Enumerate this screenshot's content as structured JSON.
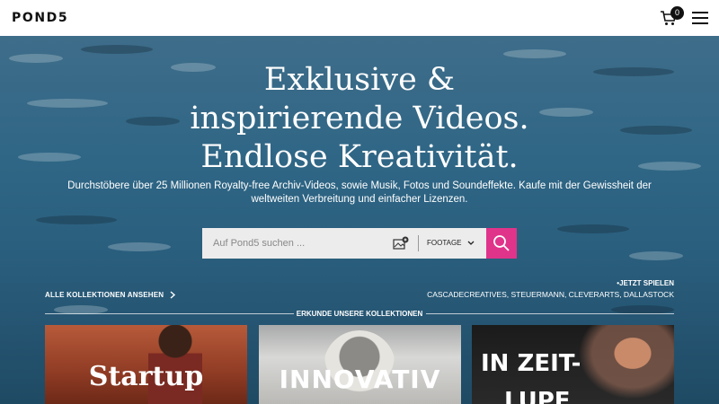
{
  "header": {
    "logo": "POND5",
    "cart_count": "0"
  },
  "hero": {
    "headline_line1": "Exklusive &",
    "headline_line2": "inspirierende Videos.",
    "headline_line3": "Endlose Kreativität.",
    "subtext": "Durchstöbere über 25 Millionen Royalty-free Archiv-Videos, sowie Musik, Fotos und Soundeffekte. Kaufe mit der Gewissheit der weltweiten Verbreitung und einfacher Lizenzen."
  },
  "search": {
    "placeholder": "Auf Pond5 suchen ...",
    "type_selected": "FOOTAGE",
    "accent_color": "#e0348a"
  },
  "links": {
    "all_collections": "ALLE KOLLEKTIONEN ANSEHEN",
    "play_now": "•JETZT SPIELEN",
    "play_names": "CASCADECREATIVES, STEUERMANN, CLEVERARTS, DALLASTOCK"
  },
  "explore": {
    "label": "ERKUNDE UNSERE KOLLEKTIONEN"
  },
  "cards": [
    {
      "title": "Startup"
    },
    {
      "title": "INNOVATIV"
    },
    {
      "title": "IN ZEIT-\nLUPE"
    }
  ]
}
